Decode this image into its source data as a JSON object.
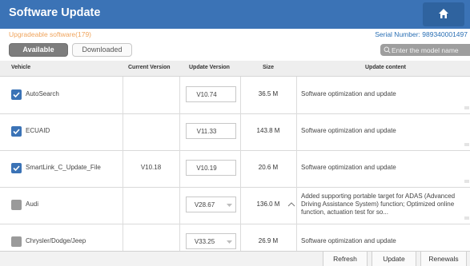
{
  "header": {
    "title": "Software Update",
    "home_icon": "home-icon"
  },
  "info": {
    "upgradeable": "Upgradeable software(179)",
    "serial": "Serial Number: 989340001497"
  },
  "tabs": {
    "available": "Available",
    "downloaded": "Downloaded"
  },
  "search": {
    "placeholder": "Enter the model name",
    "icon": "search-icon"
  },
  "table": {
    "columns": {
      "vehicle": "Vehicle",
      "current": "Current Version",
      "update": "Update Version",
      "size": "Size",
      "content": "Update content"
    },
    "rows": [
      {
        "checked": true,
        "vehicle": "AutoSearch",
        "current": "",
        "update": "V10.74",
        "size": "36.5 M",
        "content": "Software optimization and update"
      },
      {
        "checked": true,
        "vehicle": "ECUAID",
        "current": "",
        "update": "V11.33",
        "size": "143.8 M",
        "content": "Software optimization and update"
      },
      {
        "checked": true,
        "vehicle": "SmartLink_C_Update_File",
        "current": "V10.18",
        "update": "V10.19",
        "size": "20.6 M",
        "content": "Software optimization and update"
      },
      {
        "checked": false,
        "vehicle": "Audi",
        "current": "",
        "update": "V28.67",
        "size": "136.0 M",
        "content": "Added supporting portable target for ADAS (Advanced Driving Assistance System) function; Optimized online function, actuation test for so..."
      },
      {
        "checked": false,
        "vehicle": "Chrysler/Dodge/Jeep",
        "current": "",
        "update": "V33.25",
        "size": "26.9 M",
        "content": "Software optimization and update"
      }
    ]
  },
  "footer": {
    "refresh": "Refresh",
    "update": "Update",
    "renewals": "Renewals"
  },
  "colors": {
    "titlebar": "#3b73b6",
    "accent": "#2a6fb4",
    "upgradeable": "#f0a45c"
  }
}
